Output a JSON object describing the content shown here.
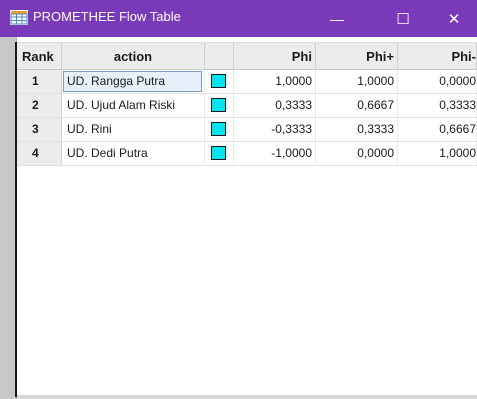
{
  "window": {
    "title": "PROMETHEE Flow Table",
    "minimize_glyph": "—",
    "maximize_glyph": "☐",
    "close_glyph": "✕"
  },
  "colors": {
    "titlebar": "#7a39b8",
    "swatch": "#00e5ee"
  },
  "table": {
    "headers": {
      "rank": "Rank",
      "action": "action",
      "phi": "Phi",
      "phi_plus": "Phi+",
      "phi_minus": "Phi-"
    },
    "rows": [
      {
        "rank": "1",
        "action": "UD. Rangga Putra",
        "phi": "1,0000",
        "phi_plus": "1,0000",
        "phi_minus": "0,0000"
      },
      {
        "rank": "2",
        "action": "UD. Ujud Alam Riski",
        "phi": "0,3333",
        "phi_plus": "0,6667",
        "phi_minus": "0,3333"
      },
      {
        "rank": "3",
        "action": "UD. Rini",
        "phi": "-0,3333",
        "phi_plus": "0,3333",
        "phi_minus": "0,6667"
      },
      {
        "rank": "4",
        "action": "UD. Dedi Putra",
        "phi": "-1,0000",
        "phi_plus": "0,0000",
        "phi_minus": "1,0000"
      }
    ]
  }
}
